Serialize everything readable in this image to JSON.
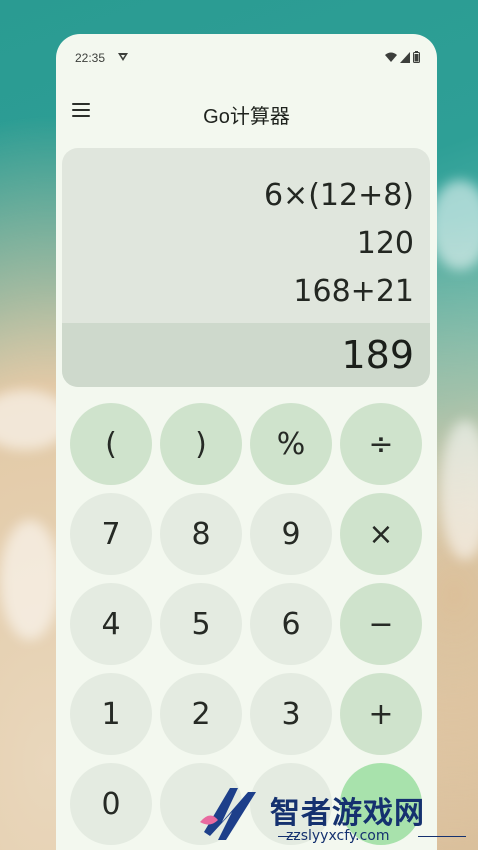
{
  "status_bar": {
    "time": "22:35"
  },
  "app_bar": {
    "title": "Go计算器"
  },
  "display": {
    "history": [
      "6×(12+8)",
      "120",
      "168+21"
    ],
    "result": "189"
  },
  "keys": [
    {
      "id": "open-paren",
      "label": "(",
      "kind": "op"
    },
    {
      "id": "close-paren",
      "label": ")",
      "kind": "op"
    },
    {
      "id": "percent",
      "label": "%",
      "kind": "op"
    },
    {
      "id": "divide",
      "label": "÷",
      "kind": "op"
    },
    {
      "id": "7",
      "label": "7",
      "kind": "num"
    },
    {
      "id": "8",
      "label": "8",
      "kind": "num"
    },
    {
      "id": "9",
      "label": "9",
      "kind": "num"
    },
    {
      "id": "multiply",
      "label": "×",
      "kind": "op"
    },
    {
      "id": "4",
      "label": "4",
      "kind": "num"
    },
    {
      "id": "5",
      "label": "5",
      "kind": "num"
    },
    {
      "id": "6",
      "label": "6",
      "kind": "num"
    },
    {
      "id": "minus",
      "label": "−",
      "kind": "op"
    },
    {
      "id": "1",
      "label": "1",
      "kind": "num"
    },
    {
      "id": "2",
      "label": "2",
      "kind": "num"
    },
    {
      "id": "3",
      "label": "3",
      "kind": "num"
    },
    {
      "id": "plus",
      "label": "+",
      "kind": "op"
    },
    {
      "id": "0",
      "label": "0",
      "kind": "num"
    }
  ],
  "watermark": {
    "text": "智者游戏网",
    "url": "zzslyyxcfy.com"
  }
}
